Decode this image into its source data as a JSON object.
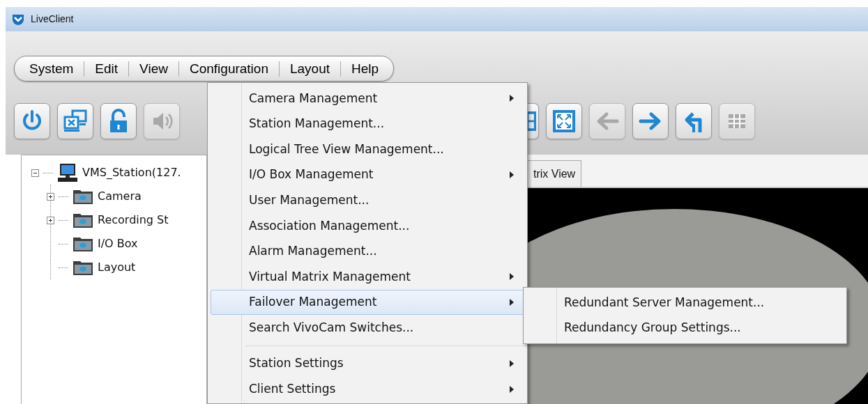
{
  "window": {
    "title": "LiveClient"
  },
  "menubar": [
    {
      "label": "System"
    },
    {
      "label": "Edit"
    },
    {
      "label": "View"
    },
    {
      "label": "Configuration"
    },
    {
      "label": "Layout"
    },
    {
      "label": "Help"
    }
  ],
  "toolbar_left": [
    {
      "kind": "power",
      "disabled": false
    },
    {
      "kind": "remote",
      "disabled": false
    },
    {
      "kind": "lock",
      "disabled": false
    },
    {
      "kind": "speaker",
      "disabled": true
    }
  ],
  "toolbar_right": [
    {
      "kind": "layout",
      "disabled": false
    },
    {
      "kind": "fullscreen",
      "disabled": false
    },
    {
      "kind": "back",
      "disabled": true
    },
    {
      "kind": "forward",
      "disabled": false
    },
    {
      "kind": "return",
      "disabled": false
    },
    {
      "kind": "grid",
      "disabled": true
    }
  ],
  "tree": {
    "label": "VMS_Station(127.",
    "expanded": true,
    "children": [
      {
        "label": "Camera",
        "expanded": false
      },
      {
        "label": "Recording St",
        "expanded": false
      },
      {
        "label": "I/O Box"
      },
      {
        "label": "Layout"
      }
    ]
  },
  "tab": {
    "label": "trix View"
  },
  "menu": [
    {
      "kind": "item",
      "label": "Camera Management",
      "submenu": true,
      "selected": false
    },
    {
      "kind": "item",
      "label": "Station Management...",
      "submenu": false,
      "selected": false
    },
    {
      "kind": "item",
      "label": "Logical Tree View Management...",
      "submenu": false,
      "selected": false
    },
    {
      "kind": "item",
      "label": "I/O Box Management",
      "submenu": true,
      "selected": false
    },
    {
      "kind": "item",
      "label": "User Management...",
      "submenu": false,
      "selected": false
    },
    {
      "kind": "item",
      "label": "Association Management...",
      "submenu": false,
      "selected": false
    },
    {
      "kind": "item",
      "label": "Alarm Management...",
      "submenu": false,
      "selected": false
    },
    {
      "kind": "item",
      "label": "Virtual Matrix Management",
      "submenu": true,
      "selected": false
    },
    {
      "kind": "item",
      "label": "Failover Management",
      "submenu": true,
      "selected": true
    },
    {
      "kind": "item",
      "label": "Search VivoCam Switches...",
      "submenu": false,
      "selected": false
    },
    {
      "kind": "separator"
    },
    {
      "kind": "item",
      "label": "Station Settings",
      "submenu": true,
      "selected": false
    },
    {
      "kind": "item",
      "label": "Client Settings",
      "submenu": true,
      "selected": false
    }
  ],
  "submenu": [
    {
      "label": "Redundant Server Management...",
      "selected": false
    },
    {
      "label": "Redundancy Group Settings...",
      "selected": false
    }
  ]
}
